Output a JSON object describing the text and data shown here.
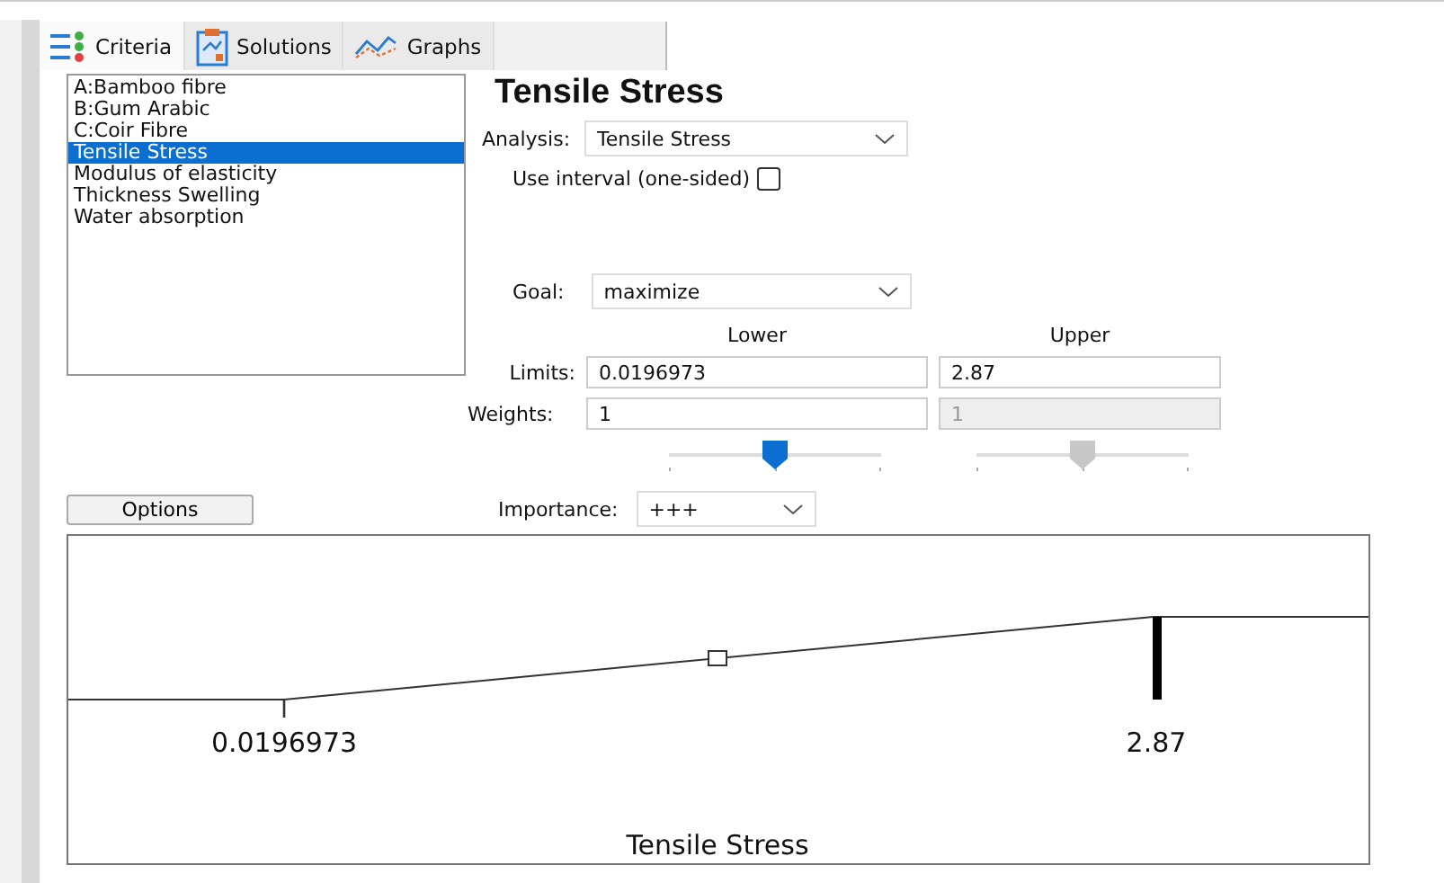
{
  "tabs": [
    {
      "label": "Criteria",
      "selected": true
    },
    {
      "label": "Solutions",
      "selected": false
    },
    {
      "label": "Graphs",
      "selected": false
    }
  ],
  "criteria_list": [
    {
      "label": "A:Bamboo fibre",
      "selected": false
    },
    {
      "label": "B:Gum Arabic",
      "selected": false
    },
    {
      "label": "C:Coir Fibre",
      "selected": false
    },
    {
      "label": "Tensile Stress",
      "selected": true
    },
    {
      "label": "Modulus of elasticity",
      "selected": false
    },
    {
      "label": "Thickness Swelling",
      "selected": false
    },
    {
      "label": "Water absorption",
      "selected": false
    }
  ],
  "title": "Tensile Stress",
  "analysis": {
    "label": "Analysis:",
    "value": "Tensile Stress"
  },
  "use_interval": {
    "label": "Use interval (one-sided)",
    "checked": false
  },
  "goal": {
    "label": "Goal:",
    "value": "maximize"
  },
  "headers": {
    "lower": "Lower",
    "upper": "Upper"
  },
  "limits": {
    "label": "Limits:",
    "lower": "0.0196973",
    "upper": "2.87"
  },
  "weights": {
    "label": "Weights:",
    "lower": "1",
    "upper": "1",
    "upper_disabled": true
  },
  "weight_sliders": [
    {
      "level": 0.5,
      "disabled": false
    },
    {
      "level": 0.5,
      "disabled": true
    }
  ],
  "options_button": "Options",
  "importance": {
    "label": "Importance:",
    "value": "+++"
  },
  "profile": {
    "low_label": "0.0196973",
    "high_label": "2.87",
    "axis_title": "Tensile Stress"
  }
}
